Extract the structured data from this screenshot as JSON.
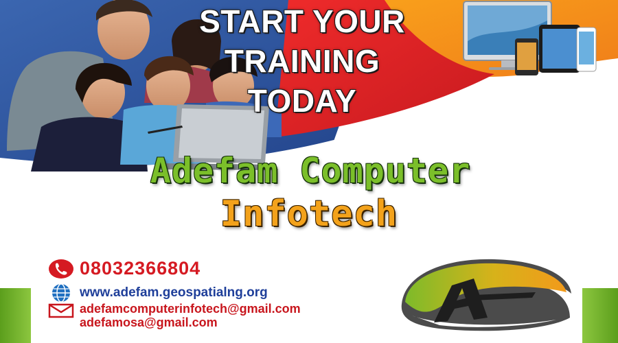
{
  "banner": {
    "headline_lines": [
      "START YOUR",
      "TRAINING",
      "TODAY"
    ]
  },
  "brand": {
    "line1": "Adefam Computer",
    "line2": "Infotech"
  },
  "contact": {
    "phone": "08032366804",
    "website": "www.adefam.geospatialng.org",
    "emails": [
      "adefamcomputerinfotech@gmail.com",
      "adefamosa@gmail.com"
    ]
  },
  "icons": {
    "phone": "phone-icon",
    "globe": "globe-icon",
    "mail": "mail-icon"
  },
  "colors": {
    "blue": "#2f5596",
    "red": "#e21f26",
    "orange": "#f7941d",
    "green": "#7bbf2a",
    "brand_orange": "#f3a21b",
    "contact_red": "#d51a22",
    "contact_blue": "#1f3f9a"
  }
}
